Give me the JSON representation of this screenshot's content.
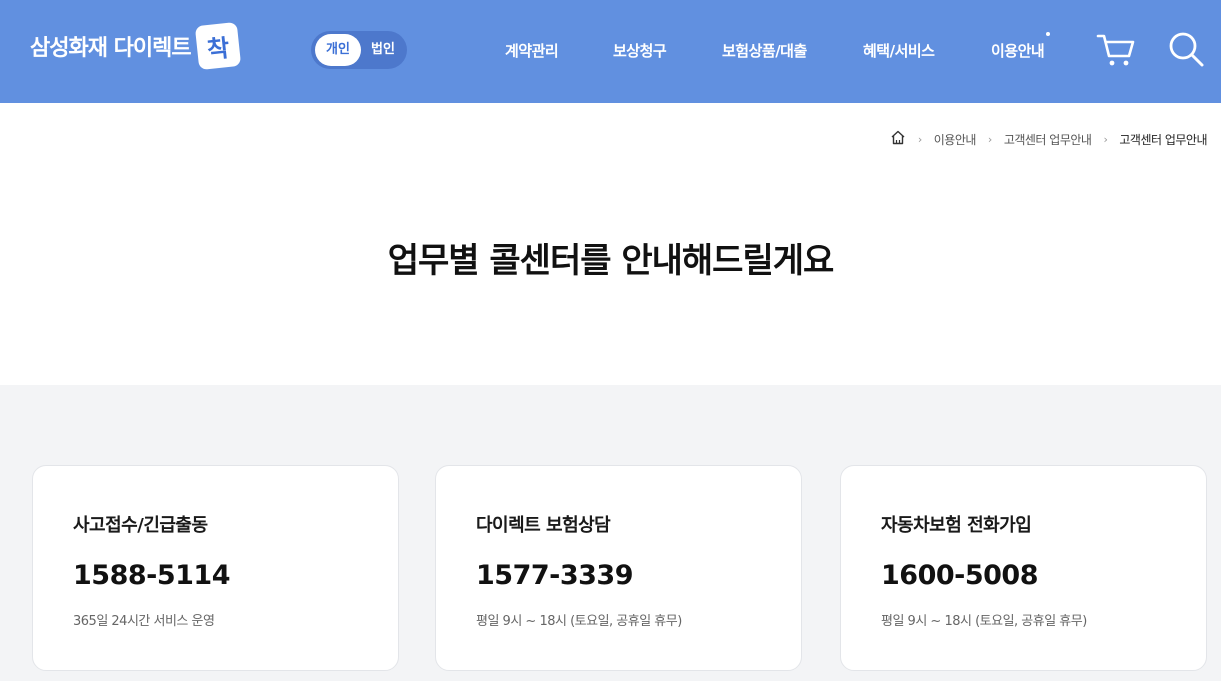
{
  "header": {
    "logo_text": "삼성화재 다이렉트",
    "logo_badge": "착",
    "toggle": {
      "personal": "개인",
      "corporate": "법인"
    },
    "nav": [
      "계약관리",
      "보상청구",
      "보험상품/대출",
      "혜택/서비스",
      "이용안내"
    ],
    "cart_icon": "cart-icon",
    "search_icon": "search-icon"
  },
  "breadcrumb": {
    "home_icon": "home-icon",
    "items": [
      "이용안내",
      "고객센터 업무안내",
      "고객센터 업무안내"
    ]
  },
  "page_title": "업무별 콜센터를 안내해드릴게요",
  "cards": [
    {
      "title": "사고접수/긴급출동",
      "number": "1588-5114",
      "note": "365일 24시간 서비스 운영"
    },
    {
      "title": "다이렉트 보험상담",
      "number": "1577-3339",
      "note": "평일 9시 ~ 18시 (토요일, 공휴일 휴무)"
    },
    {
      "title": "자동차보험 전화가입",
      "number": "1600-5008",
      "note": "평일 9시 ~ 18시 (토요일, 공휴일 휴무)"
    }
  ],
  "colors": {
    "header_bg": "#6190e0",
    "content_bg": "#f3f4f6",
    "accent": "#3b6fd6"
  }
}
